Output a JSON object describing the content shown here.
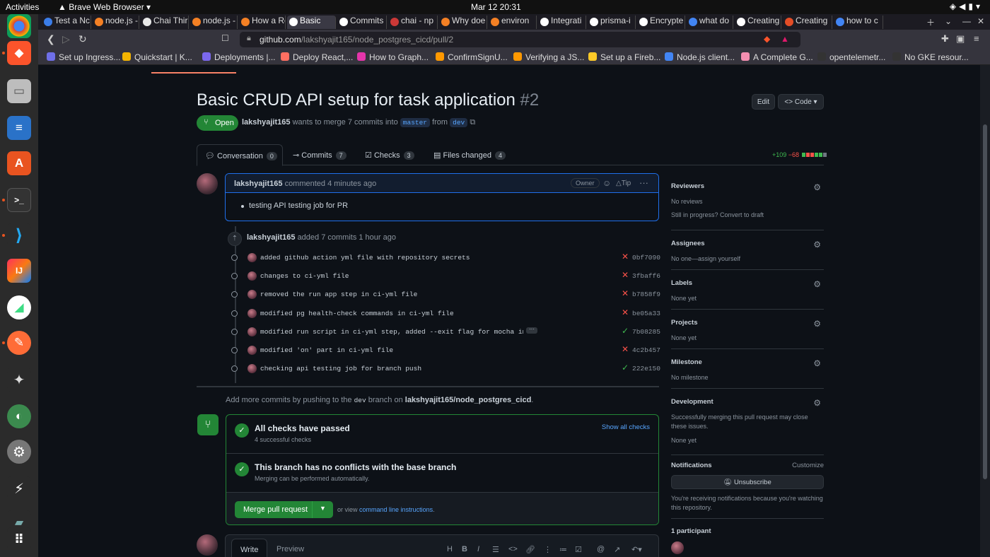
{
  "os": {
    "activities": "Activities",
    "app_name": "Brave Web Browser",
    "clock": "Mar 12  20:31"
  },
  "tabs": [
    {
      "label": "Test a Nc",
      "color": "#3b7de9"
    },
    {
      "label": "node.js -",
      "color": "#f48024"
    },
    {
      "label": "Chai Thir",
      "color": "#e8e8e8"
    },
    {
      "label": "node.js -",
      "color": "#f48024"
    },
    {
      "label": "How a Re",
      "color": "#f48024"
    },
    {
      "label": "Basic",
      "color": "#ffffff"
    },
    {
      "label": "Commits",
      "color": "#ffffff"
    },
    {
      "label": "chai - np",
      "color": "#cb3837"
    },
    {
      "label": "Why doe",
      "color": "#f48024"
    },
    {
      "label": "environ",
      "color": "#f48024"
    },
    {
      "label": "Integrati",
      "color": "#ffffff"
    },
    {
      "label": "prisma-i",
      "color": "#ffffff"
    },
    {
      "label": "Encrypte",
      "color": "#ffffff"
    },
    {
      "label": "what do",
      "color": "#4285f4"
    },
    {
      "label": "Creating",
      "color": "#ffffff"
    },
    {
      "label": "Creating",
      "color": "#e44d26"
    },
    {
      "label": "how to c",
      "color": "#4285f4"
    }
  ],
  "address": {
    "host": "github.com",
    "path": "/lakshyajit165/node_postgres_cicd/pull/2"
  },
  "bookmarks": [
    {
      "label": "Set up Ingress...",
      "color": "#6f6fe8"
    },
    {
      "label": "Quickstart  |  K...",
      "color": "#f4b400"
    },
    {
      "label": "Deployments |...",
      "color": "#7b68ee"
    },
    {
      "label": "Deploy React,...",
      "color": "#ff6f61"
    },
    {
      "label": "How to Graph...",
      "color": "#e535ab"
    },
    {
      "label": "ConfirmSignU...",
      "color": "#ff9900"
    },
    {
      "label": "Verifying a JS...",
      "color": "#ff9900"
    },
    {
      "label": "Set up a Fireb...",
      "color": "#ffca28"
    },
    {
      "label": "Node.js client...",
      "color": "#4285f4"
    },
    {
      "label": "A Complete G...",
      "color": "#f48fb1"
    },
    {
      "label": "opentelemetr...",
      "color": "#333333"
    },
    {
      "label": "No GKE resour...",
      "color": "#333333"
    }
  ],
  "pr": {
    "title": "Basic CRUD API setup for task application",
    "number": "#2",
    "edit_label": "Edit",
    "code_label": "<> Code ▾",
    "status": "Open",
    "author": "lakshyajit165",
    "merge_text": "wants to merge 7 commits into",
    "base_branch": "master",
    "from_text": "from",
    "head_branch": "dev"
  },
  "pr_tabs": [
    {
      "label": "Conversation",
      "count": "0"
    },
    {
      "label": "Commits",
      "count": "7"
    },
    {
      "label": "Checks",
      "count": "3"
    },
    {
      "label": "Files changed",
      "count": "4"
    }
  ],
  "diffstat": {
    "additions": "+109",
    "deletions": "−68"
  },
  "comment": {
    "author": "lakshyajit165",
    "meta": "commented 4 minutes ago",
    "badge": "Owner",
    "tip": "Tip",
    "body": "testing API testing job for PR"
  },
  "commits_event": {
    "author": "lakshyajit165",
    "meta": "added 7 commits 1 hour ago"
  },
  "commits": [
    {
      "message": "added github action yml file with repository secrets",
      "status": "fail",
      "sha": "0bf7090"
    },
    {
      "message": "changes to ci-yml file",
      "status": "fail",
      "sha": "3fbaff6"
    },
    {
      "message": "removed the run app step in ci-yml file",
      "status": "fail",
      "sha": "b7858f9"
    },
    {
      "message": "modified pg health-check commands in ci-yml file",
      "status": "fail",
      "sha": "be05a33"
    },
    {
      "message": "modified run script in ci-yml step, added --exit flag for mocha in pa…",
      "status": "pass",
      "sha": "7b08285"
    },
    {
      "message": "modified 'on' part in ci-yml file",
      "status": "fail",
      "sha": "4c2b457"
    },
    {
      "message": "checking api testing job for branch push",
      "status": "pass",
      "sha": "222e150"
    }
  ],
  "add_more": {
    "prefix": "Add more commits by pushing to the",
    "branch": "dev",
    "middle": "branch on",
    "repo": "lakshyajit165/node_postgres_cicd",
    "suffix": "."
  },
  "merge": {
    "checks_title": "All checks have passed",
    "checks_sub": "4 successful checks",
    "show_all": "Show all checks",
    "conflicts_title": "This branch has no conflicts with the base branch",
    "conflicts_sub": "Merging can be performed automatically.",
    "button": "Merge pull request",
    "or_view": "or view",
    "cli_link": "command line instructions",
    "cli_suffix": "."
  },
  "editor": {
    "write": "Write",
    "preview": "Preview"
  },
  "sidebar": {
    "reviewers": {
      "title": "Reviewers",
      "value": "No reviews",
      "extra": "Still in progress? Convert to draft"
    },
    "assignees": {
      "title": "Assignees",
      "value": "No one—assign yourself"
    },
    "labels": {
      "title": "Labels",
      "value": "None yet"
    },
    "projects": {
      "title": "Projects",
      "value": "None yet"
    },
    "milestone": {
      "title": "Milestone",
      "value": "No milestone"
    },
    "development": {
      "title": "Development",
      "value": "Successfully merging this pull request may close these issues.",
      "extra": "None yet"
    },
    "notifications": {
      "title": "Notifications",
      "customize": "Customize",
      "button": "Unsubscribe",
      "note": "You're receiving notifications because you're watching this repository."
    },
    "participants": {
      "title": "1 participant"
    }
  }
}
